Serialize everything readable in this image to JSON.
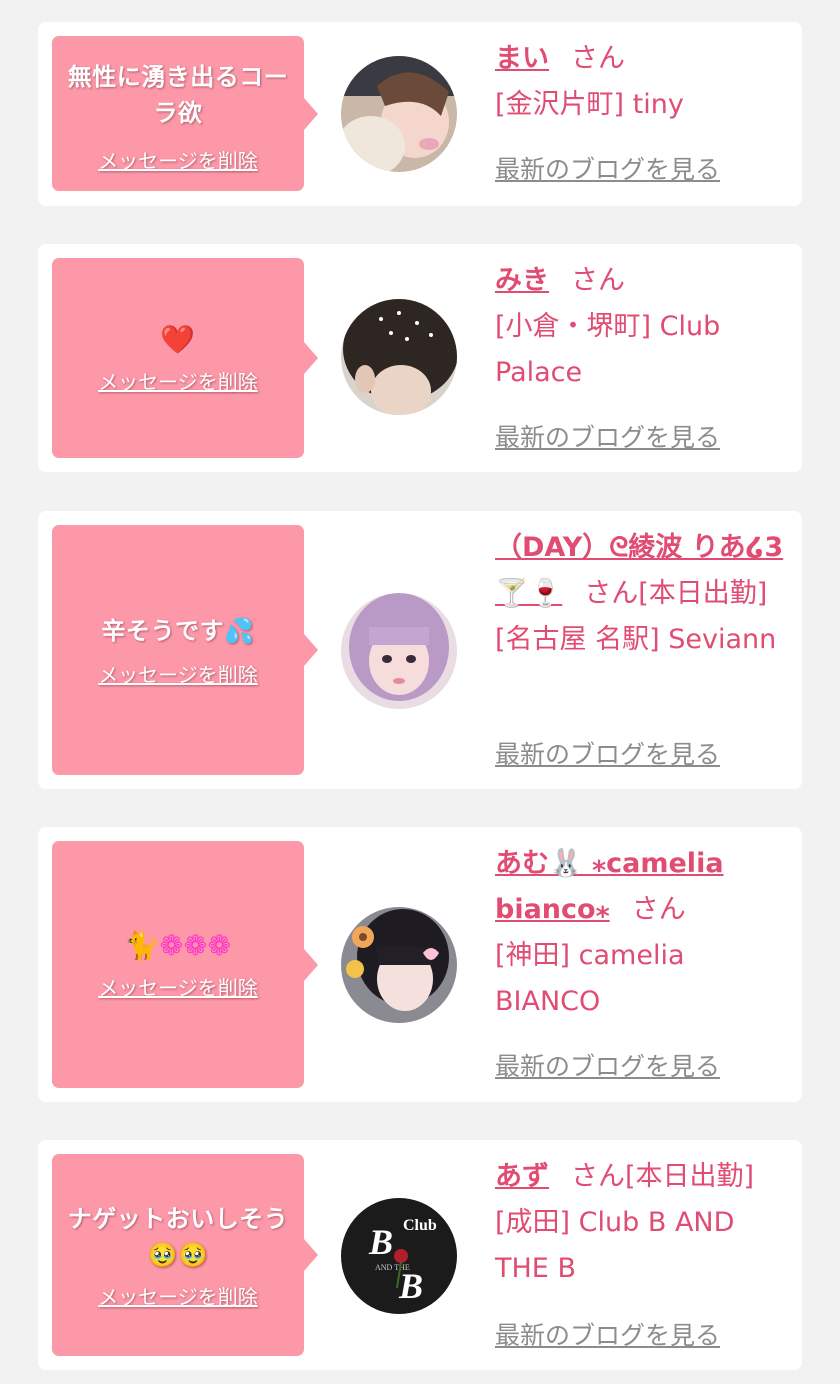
{
  "common": {
    "delete_label": "メッセージを削除",
    "blog_label": "最新のブログを見る",
    "san": "さん"
  },
  "colors": {
    "background": "#f2f2f2",
    "card": "#ffffff",
    "bubble": "#fc98a8",
    "accent": "#e04c72",
    "link_gray": "#8c8c8c"
  },
  "messages": [
    {
      "text": "無性に湧き出るコーラ欲",
      "name": "まい",
      "suffix": "さん",
      "shop": "[金沢片町] tiny",
      "avatar_icon": "photo-icon"
    },
    {
      "text": "❤️",
      "name": "みき",
      "suffix": "さん",
      "shop": "[小倉・堺町] Club Palace",
      "avatar_icon": "photo-icon"
    },
    {
      "text": "辛そうです💦",
      "name": "（DAY）ᘓ綾波 りあ໒3🍸🍷",
      "suffix": "さん[本日出勤]",
      "shop": "[名古屋 名駅] Seviann",
      "avatar_icon": "photo-icon"
    },
    {
      "text": "🐈❁❁❁",
      "name": "あむ🐰 ⁎camelia bianco⁎",
      "suffix": "さん",
      "shop": "[神田] camelia BIANCO",
      "avatar_icon": "photo-icon"
    },
    {
      "text": "ナゲットおいしそう🥹🥹",
      "name": "あず",
      "suffix": "さん[本日出勤]",
      "shop": "[成田] Club B AND THE B",
      "avatar_icon": "club-logo-icon",
      "avatar_logo": {
        "top": "Club",
        "letters": "B",
        "middle": "AND THE"
      }
    }
  ]
}
